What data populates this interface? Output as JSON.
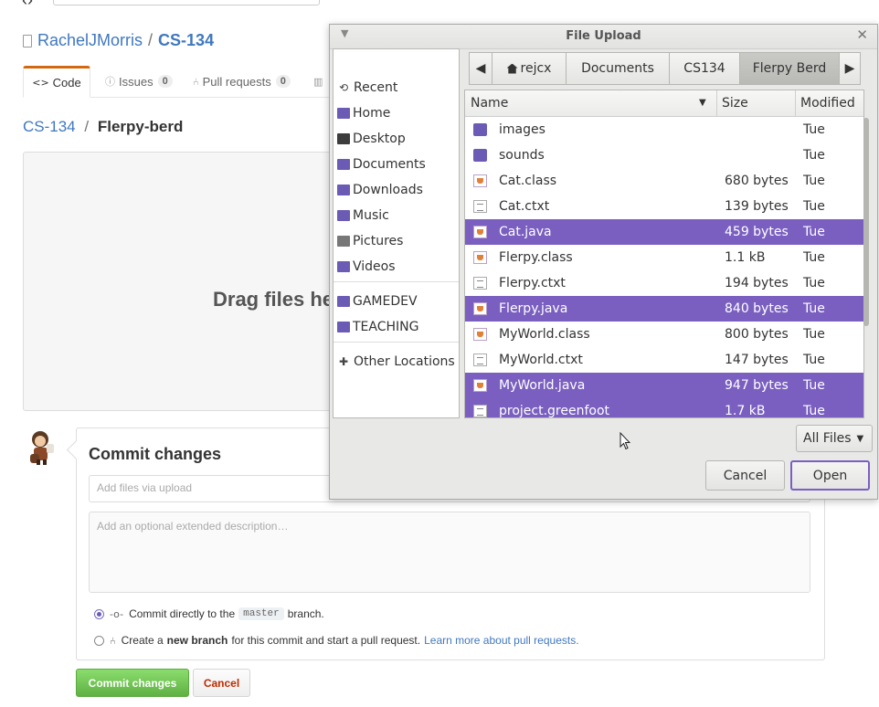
{
  "github": {
    "owner": "RachelJMorris",
    "separator": "/",
    "repo": "CS-134",
    "tabs": [
      {
        "label": "Code",
        "icon": "code-icon"
      },
      {
        "label": "Issues",
        "count": "0",
        "icon": "issue-icon"
      },
      {
        "label": "Pull requests",
        "count": "0",
        "icon": "pull-request-icon"
      }
    ],
    "breadcrumb": {
      "repo_link": "CS-134",
      "separator": "/",
      "folder": "Flerpy-berd"
    },
    "dropzone_text": "Drag files he",
    "commit": {
      "heading": "Commit changes",
      "summary_placeholder": "Add files via upload",
      "description_placeholder": "Add an optional extended description…",
      "option_direct_pre": "Commit directly to the",
      "option_direct_branch": "master",
      "option_direct_post": "branch.",
      "option_new_pre": "Create a",
      "option_new_bold": "new branch",
      "option_new_post": "for this commit and start a pull request.",
      "option_new_link": "Learn more about pull requests.",
      "commit_button": "Commit changes",
      "cancel_button": "Cancel"
    }
  },
  "dialog": {
    "title": "File Upload",
    "places": [
      {
        "label": "Recent",
        "icon": "clock-icon"
      },
      {
        "label": "Home",
        "icon": "home-folder-icon"
      },
      {
        "label": "Desktop",
        "icon": "desktop-icon"
      },
      {
        "label": "Documents",
        "icon": "documents-folder-icon"
      },
      {
        "label": "Downloads",
        "icon": "downloads-folder-icon"
      },
      {
        "label": "Music",
        "icon": "music-folder-icon"
      },
      {
        "label": "Pictures",
        "icon": "pictures-folder-icon"
      },
      {
        "label": "Videos",
        "icon": "videos-folder-icon"
      }
    ],
    "bookmarks": [
      {
        "label": "GAMEDEV",
        "icon": "folder-icon"
      },
      {
        "label": "TEACHING",
        "icon": "folder-icon"
      }
    ],
    "other_locations": "Other Locations",
    "path": [
      "rejcx",
      "Documents",
      "CS134",
      "Flerpy Berd"
    ],
    "columns": {
      "name": "Name",
      "size": "Size",
      "modified": "Modified"
    },
    "files": [
      {
        "name": "images",
        "size": "",
        "modified": "Tue",
        "type": "folder",
        "selected": false
      },
      {
        "name": "sounds",
        "size": "",
        "modified": "Tue",
        "type": "folder",
        "selected": false
      },
      {
        "name": "Cat.class",
        "size": "680 bytes",
        "modified": "Tue",
        "type": "java",
        "selected": false
      },
      {
        "name": "Cat.ctxt",
        "size": "139 bytes",
        "modified": "Tue",
        "type": "text",
        "selected": false
      },
      {
        "name": "Cat.java",
        "size": "459 bytes",
        "modified": "Tue",
        "type": "java",
        "selected": true
      },
      {
        "name": "Flerpy.class",
        "size": "1.1 kB",
        "modified": "Tue",
        "type": "java",
        "selected": false
      },
      {
        "name": "Flerpy.ctxt",
        "size": "194 bytes",
        "modified": "Tue",
        "type": "text",
        "selected": false
      },
      {
        "name": "Flerpy.java",
        "size": "840 bytes",
        "modified": "Tue",
        "type": "java",
        "selected": true
      },
      {
        "name": "MyWorld.class",
        "size": "800 bytes",
        "modified": "Tue",
        "type": "java",
        "selected": false
      },
      {
        "name": "MyWorld.ctxt",
        "size": "147 bytes",
        "modified": "Tue",
        "type": "text",
        "selected": false
      },
      {
        "name": "MyWorld.java",
        "size": "947 bytes",
        "modified": "Tue",
        "type": "java",
        "selected": true
      },
      {
        "name": "project.greenfoot",
        "size": "1.7 kB",
        "modified": "Tue",
        "type": "text",
        "selected": true
      }
    ],
    "filter": "All Files",
    "cancel_button": "Cancel",
    "open_button": "Open"
  }
}
